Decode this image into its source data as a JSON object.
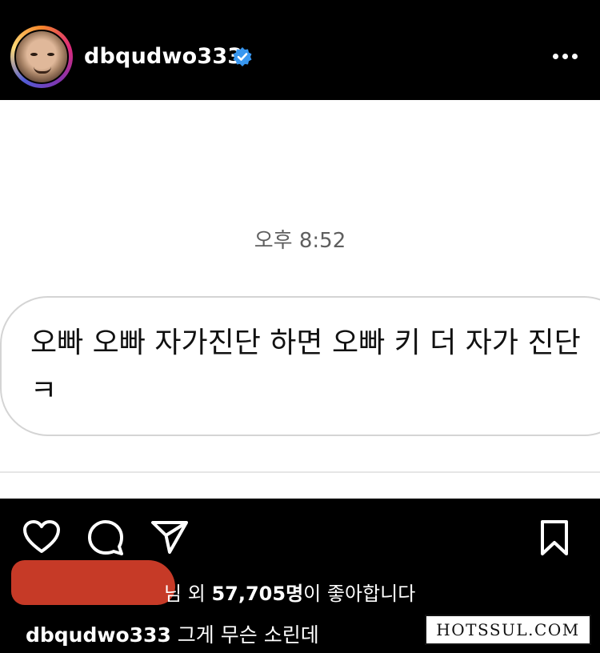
{
  "header": {
    "username": "dbqudwo333",
    "verified_color": "#3897f0",
    "avatar_icon": "profile-photo",
    "more_icon": "more-horizontal-icon"
  },
  "post": {
    "timestamp": "오후 8:52",
    "message": "오빠 오빠 자가진단 하면 오빠 키 더 자가 진단 ㅋ"
  },
  "actions": {
    "icons": [
      "heart-icon",
      "comment-icon",
      "share-icon",
      "bookmark-icon"
    ]
  },
  "likes": {
    "suffix_name": "님",
    "text": "외",
    "count": "57,705명",
    "tail": "이 좋아합니다"
  },
  "caption": {
    "username": "dbqudwo333",
    "text": "그게 무슨 소린데"
  },
  "watermark": "HOTSSUL.COM",
  "colors": {
    "background": "#000000",
    "post_background": "#ffffff",
    "redaction": "#c63a27"
  }
}
